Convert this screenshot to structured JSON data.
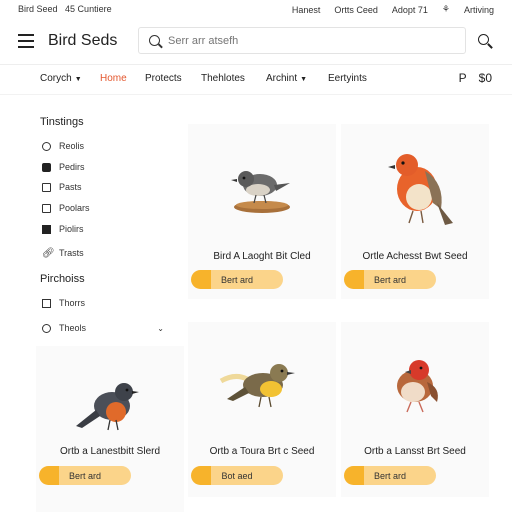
{
  "topbar": {
    "store": "Bird Seed",
    "tagline": "45 Cuntiere",
    "links": [
      "Hanest",
      "Ortts Ceed",
      "Adopt 71",
      "Artiving"
    ]
  },
  "header": {
    "brand": "Bird Seds",
    "search_placeholder": "Serr arr atsefh"
  },
  "nav": {
    "items": [
      {
        "label": "Corych",
        "dropdown": true,
        "active": false
      },
      {
        "label": "Home",
        "dropdown": false,
        "active": true
      },
      {
        "label": "Protects",
        "dropdown": false,
        "active": false
      },
      {
        "label": "Thehlotes",
        "dropdown": false,
        "active": false
      },
      {
        "label": "Archint",
        "dropdown": true,
        "active": false
      },
      {
        "label": "Eertyints",
        "dropdown": false,
        "active": false
      }
    ],
    "tools": {
      "search": "P",
      "currency": "$",
      "cart": "0"
    }
  },
  "sidebar": {
    "heading1": "Tinstings",
    "items1": [
      {
        "label": "Reolis",
        "icon": "circle-icon"
      },
      {
        "label": "Pedirs",
        "icon": "square-filled-icon"
      },
      {
        "label": "Pasts",
        "icon": "square-icon"
      },
      {
        "label": "Poolars",
        "icon": "tag-icon"
      },
      {
        "label": "Piolirs",
        "icon": "box-icon"
      },
      {
        "label": "Trasts",
        "icon": "link-icon"
      }
    ],
    "heading2": "Pirchoiss",
    "items2": [
      {
        "label": "Thorrs",
        "icon": "document-icon"
      },
      {
        "label": "Theols",
        "icon": "clock-icon",
        "expandable": true
      }
    ]
  },
  "products": [
    {
      "title": "Bird A Laoght Bit Cled",
      "button": "Bert ard",
      "bird": "titmouse"
    },
    {
      "title": "Ortle Achesst Bwt Seed",
      "button": "Bert ard",
      "bird": "robin"
    },
    {
      "title": "Ortb a Lanestbitt Slerd",
      "button": "Bert ard",
      "bird": "redstart"
    },
    {
      "title": "Ortb a Toura Brt c Seed",
      "button": "Bot aed",
      "bird": "warbler"
    },
    {
      "title": "Ortb a Lansst Brt Seed",
      "button": "Bert ard",
      "bird": "finch"
    }
  ],
  "colors": {
    "accent": "#e4572e",
    "button": "#f7b32b",
    "button_light": "#fbd48a"
  }
}
